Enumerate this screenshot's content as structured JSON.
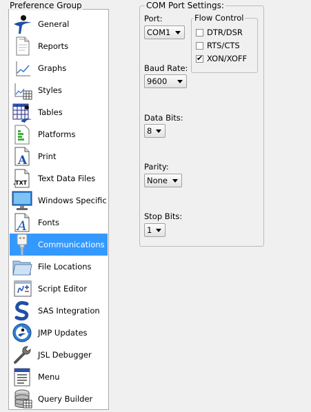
{
  "preference_group": {
    "title": "Preference Group",
    "selected": "Communications",
    "items": [
      {
        "label": "General",
        "icon": "general-icon"
      },
      {
        "label": "Reports",
        "icon": "reports-icon"
      },
      {
        "label": "Graphs",
        "icon": "graphs-icon"
      },
      {
        "label": "Styles",
        "icon": "styles-icon"
      },
      {
        "label": "Tables",
        "icon": "tables-icon"
      },
      {
        "label": "Platforms",
        "icon": "platforms-icon"
      },
      {
        "label": "Print",
        "icon": "print-icon"
      },
      {
        "label": "Text Data Files",
        "icon": "text-data-files-icon"
      },
      {
        "label": "Windows Specific",
        "icon": "windows-specific-icon"
      },
      {
        "label": "Fonts",
        "icon": "fonts-icon"
      },
      {
        "label": "Communications",
        "icon": "communications-icon"
      },
      {
        "label": "File Locations",
        "icon": "file-locations-icon"
      },
      {
        "label": "Script Editor",
        "icon": "script-editor-icon"
      },
      {
        "label": "SAS Integration",
        "icon": "sas-integration-icon"
      },
      {
        "label": "JMP Updates",
        "icon": "jmp-updates-icon"
      },
      {
        "label": "JSL Debugger",
        "icon": "jsl-debugger-icon"
      },
      {
        "label": "Menu",
        "icon": "menu-icon"
      },
      {
        "label": "Query Builder",
        "icon": "query-builder-icon"
      }
    ]
  },
  "com_port": {
    "title": "COM Port Settings:",
    "port": {
      "label": "Port:",
      "value": "COM1"
    },
    "baud_rate": {
      "label": "Baud Rate:",
      "value": "9600"
    },
    "data_bits": {
      "label": "Data Bits:",
      "value": "8"
    },
    "parity": {
      "label": "Parity:",
      "value": "None"
    },
    "stop_bits": {
      "label": "Stop Bits:",
      "value": "1"
    },
    "flow_control": {
      "title": "Flow Control",
      "options": [
        {
          "label": "DTR/DSR",
          "checked": false
        },
        {
          "label": "RTS/CTS",
          "checked": false
        },
        {
          "label": "XON/XOFF",
          "checked": true
        }
      ]
    }
  }
}
